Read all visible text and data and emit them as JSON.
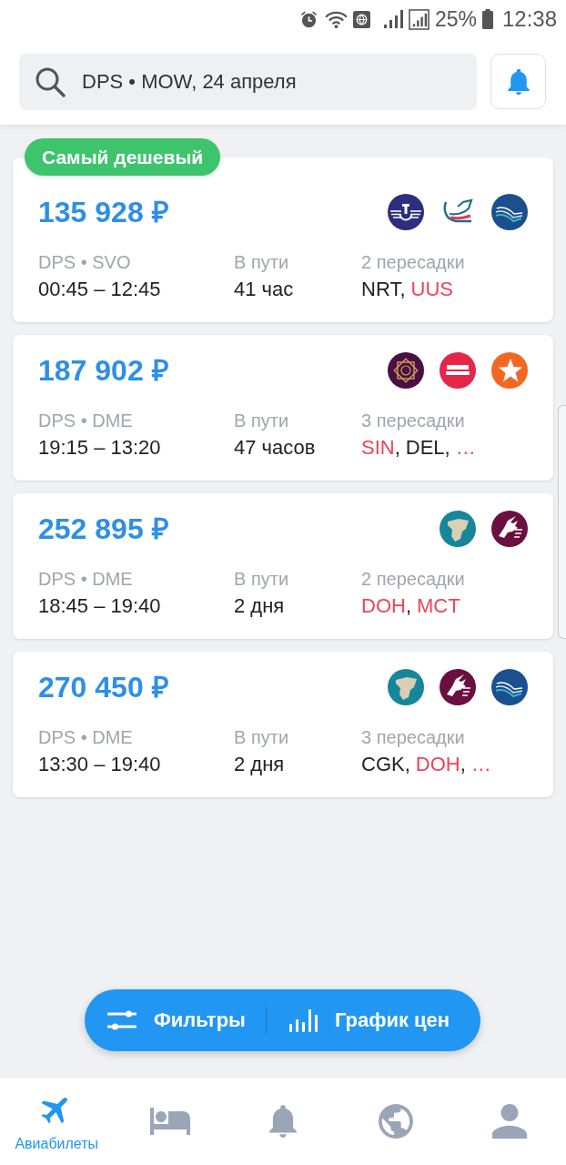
{
  "status_bar": {
    "battery": "25%",
    "time": "12:38"
  },
  "search": {
    "value": "DPS • MOW, 24 апреля"
  },
  "results": [
    {
      "badge": "Самый дешевый",
      "price": "135 928 ₽",
      "airlines": [
        {
          "kind": "wings"
        },
        {
          "kind": "swoosh"
        },
        {
          "kind": "wave"
        }
      ],
      "route": "DPS • SVO",
      "times": "00:45 – 12:45",
      "duration_label": "В пути",
      "duration": "41 час",
      "stops_label": "2 пересадки",
      "stops": [
        {
          "code": "NRT",
          "alert": false,
          "sep": ","
        },
        {
          "code": "UUS",
          "alert": true
        }
      ]
    },
    {
      "price": "187 902 ₽",
      "airlines": [
        {
          "kind": "ornament"
        },
        {
          "kind": "lettering"
        },
        {
          "kind": "star"
        }
      ],
      "route": "DPS • DME",
      "times": "19:15 – 13:20",
      "duration_label": "В пути",
      "duration": "47 часов",
      "stops_label": "3 пересадки",
      "stops": [
        {
          "code": "SIN",
          "alert": true,
          "sep": ","
        },
        {
          "code": "DEL",
          "alert": false,
          "sep": ","
        },
        {
          "code": "…",
          "alert": true
        }
      ]
    },
    {
      "price": "252 895 ₽",
      "airlines": [
        {
          "kind": "map"
        },
        {
          "kind": "oryx"
        }
      ],
      "route": "DPS • DME",
      "times": "18:45 – 19:40",
      "duration_label": "В пути",
      "duration": "2 дня",
      "stops_label": "2 пересадки",
      "stops": [
        {
          "code": "DOH",
          "alert": true,
          "sep": ","
        },
        {
          "code": "MCT",
          "alert": true
        }
      ]
    },
    {
      "price": "270 450 ₽",
      "airlines": [
        {
          "kind": "map"
        },
        {
          "kind": "oryx"
        },
        {
          "kind": "wave"
        }
      ],
      "route": "DPS • DME",
      "times": "13:30 – 19:40",
      "duration_label": "В пути",
      "duration": "2 дня",
      "stops_label": "3 пересадки",
      "stops": [
        {
          "code": "CGK",
          "alert": false,
          "sep": ","
        },
        {
          "code": "DOH",
          "alert": true,
          "sep": ","
        },
        {
          "code": "…",
          "alert": true
        }
      ]
    }
  ],
  "actions": [
    {
      "kind": "filters",
      "label": "Фильтры"
    },
    {
      "kind": "price_chart",
      "label": "График цен"
    }
  ],
  "tabs": [
    {
      "kind": "flights",
      "label": "Авиабилеты",
      "selected": true
    },
    {
      "kind": "hotels",
      "selected": false
    },
    {
      "kind": "alerts",
      "selected": false
    },
    {
      "kind": "explore",
      "selected": false
    },
    {
      "kind": "profile",
      "selected": false
    }
  ]
}
